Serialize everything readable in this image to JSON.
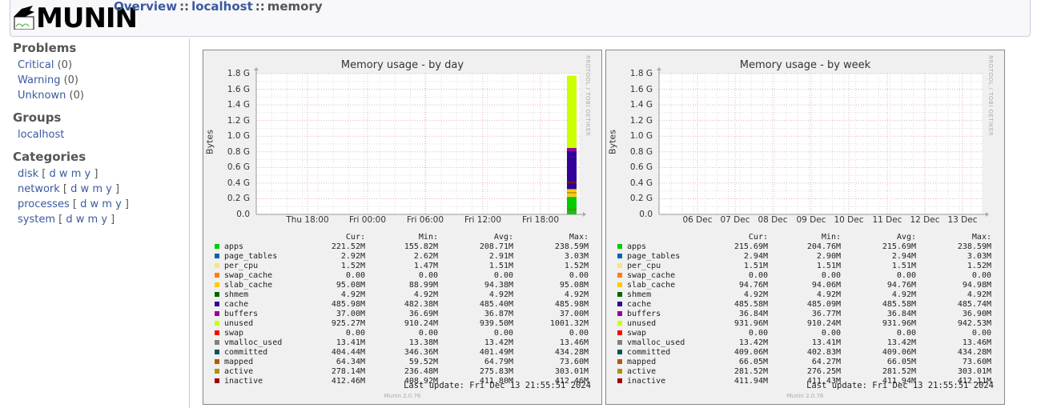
{
  "header": {
    "logo_text": "MUNIN",
    "breadcrumb": [
      {
        "label": "Overview",
        "link": true
      },
      {
        "label": "localhost",
        "link": true
      },
      {
        "label": "memory",
        "link": false
      }
    ],
    "separator": "::"
  },
  "sidebar": {
    "problems": {
      "title": "Problems",
      "items": [
        {
          "label": "Critical",
          "count": "(0)"
        },
        {
          "label": "Warning",
          "count": "(0)"
        },
        {
          "label": "Unknown",
          "count": "(0)"
        }
      ]
    },
    "groups": {
      "title": "Groups",
      "items": [
        "localhost"
      ]
    },
    "categories": {
      "title": "Categories",
      "items": [
        "disk",
        "network",
        "processes",
        "system"
      ],
      "periods": [
        "d",
        "w",
        "m",
        "y"
      ]
    }
  },
  "graphs": [
    {
      "title": "Memory usage - by day",
      "ylabel": "Bytes",
      "side_text": "RRDTOOL / TOBI OETIKER",
      "yticks": [
        "1.8 G",
        "1.6 G",
        "1.4 G",
        "1.2 G",
        "1.0 G",
        "0.8 G",
        "0.6 G",
        "0.4 G",
        "0.2 G",
        "0.0"
      ],
      "xticks": [
        "Thu 18:00",
        "Fri 00:00",
        "Fri 06:00",
        "Fri 12:00",
        "Fri 18:00"
      ],
      "headers": [
        "Cur:",
        "Min:",
        "Avg:",
        "Max:"
      ],
      "rows": [
        [
          "apps",
          "221.52M",
          "155.82M",
          "208.71M",
          "238.59M"
        ],
        [
          "page_tables",
          "2.92M",
          "2.62M",
          "2.91M",
          "3.03M"
        ],
        [
          "per_cpu",
          "1.52M",
          "1.47M",
          "1.51M",
          "1.52M"
        ],
        [
          "swap_cache",
          "0.00",
          "0.00",
          "0.00",
          "0.00"
        ],
        [
          "slab_cache",
          "95.08M",
          "88.99M",
          "94.38M",
          "95.08M"
        ],
        [
          "shmem",
          "4.92M",
          "4.92M",
          "4.92M",
          "4.92M"
        ],
        [
          "cache",
          "485.98M",
          "482.38M",
          "485.40M",
          "485.98M"
        ],
        [
          "buffers",
          "37.00M",
          "36.69M",
          "36.87M",
          "37.00M"
        ],
        [
          "unused",
          "925.27M",
          "910.24M",
          "939.50M",
          "1001.32M"
        ],
        [
          "swap",
          "0.00",
          "0.00",
          "0.00",
          "0.00"
        ],
        [
          "vmalloc_used",
          "13.41M",
          "13.38M",
          "13.42M",
          "13.46M"
        ],
        [
          "committed",
          "404.44M",
          "346.36M",
          "401.49M",
          "434.28M"
        ],
        [
          "mapped",
          "64.34M",
          "59.52M",
          "64.79M",
          "73.60M"
        ],
        [
          "active",
          "278.14M",
          "236.48M",
          "275.83M",
          "303.01M"
        ],
        [
          "inactive",
          "412.46M",
          "408.92M",
          "411.80M",
          "412.46M"
        ]
      ],
      "last_update": "Last update: Fri Dec 13 21:55:51 2024",
      "version": "Munin 2.0.76"
    },
    {
      "title": "Memory usage - by week",
      "ylabel": "Bytes",
      "side_text": "RRDTOOL / TOBI OETIKER",
      "yticks": [
        "1.8 G",
        "1.6 G",
        "1.4 G",
        "1.2 G",
        "1.0 G",
        "0.8 G",
        "0.6 G",
        "0.4 G",
        "0.2 G",
        "0.0"
      ],
      "xticks": [
        "06 Dec",
        "07 Dec",
        "08 Dec",
        "09 Dec",
        "10 Dec",
        "11 Dec",
        "12 Dec",
        "13 Dec"
      ],
      "headers": [
        "Cur:",
        "Min:",
        "Avg:",
        "Max:"
      ],
      "rows": [
        [
          "apps",
          "215.69M",
          "204.76M",
          "215.69M",
          "238.59M"
        ],
        [
          "page_tables",
          "2.94M",
          "2.90M",
          "2.94M",
          "3.03M"
        ],
        [
          "per_cpu",
          "1.51M",
          "1.51M",
          "1.51M",
          "1.52M"
        ],
        [
          "swap_cache",
          "0.00",
          "0.00",
          "0.00",
          "0.00"
        ],
        [
          "slab_cache",
          "94.76M",
          "94.06M",
          "94.76M",
          "94.98M"
        ],
        [
          "shmem",
          "4.92M",
          "4.92M",
          "4.92M",
          "4.92M"
        ],
        [
          "cache",
          "485.58M",
          "485.09M",
          "485.58M",
          "485.74M"
        ],
        [
          "buffers",
          "36.84M",
          "36.77M",
          "36.84M",
          "36.90M"
        ],
        [
          "unused",
          "931.96M",
          "910.24M",
          "931.96M",
          "942.53M"
        ],
        [
          "swap",
          "0.00",
          "0.00",
          "0.00",
          "0.00"
        ],
        [
          "vmalloc_used",
          "13.42M",
          "13.41M",
          "13.42M",
          "13.46M"
        ],
        [
          "committed",
          "409.06M",
          "402.83M",
          "409.06M",
          "434.28M"
        ],
        [
          "mapped",
          "66.05M",
          "64.27M",
          "66.05M",
          "73.60M"
        ],
        [
          "active",
          "281.52M",
          "276.25M",
          "281.52M",
          "303.01M"
        ],
        [
          "inactive",
          "411.94M",
          "411.43M",
          "411.94M",
          "412.11M"
        ]
      ],
      "last_update": "Last update: Fri Dec 13 21:55:51 2024",
      "version": "Munin 2.0.76"
    }
  ],
  "colors": {
    "apps": "#00cc00",
    "page_tables": "#0066b3",
    "per_cpu": "#ffe082",
    "swap_cache": "#ff8000",
    "slab_cache": "#ffcc00",
    "shmem": "#006600",
    "cache": "#330099",
    "buffers": "#990099",
    "unused": "#ccff00",
    "swap": "#ff0000",
    "vmalloc_used": "#808080",
    "committed": "#00545f",
    "mapped": "#b35a00",
    "active": "#b38f00",
    "inactive": "#a00000"
  }
}
